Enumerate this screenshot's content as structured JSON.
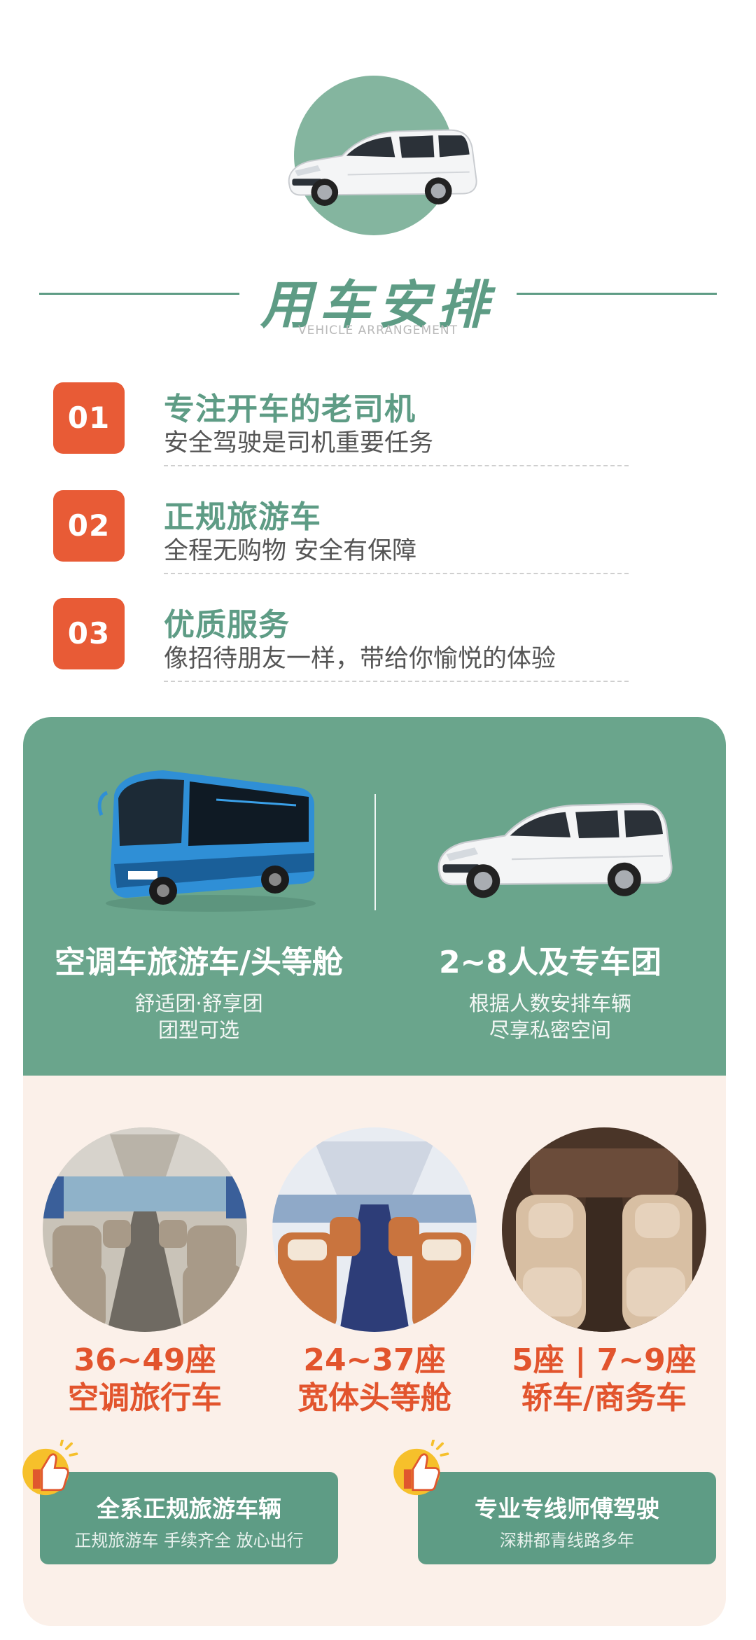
{
  "header": {
    "title": "用车安排",
    "subtitle": "VEHICLE ARRANGEMENT"
  },
  "features": [
    {
      "num": "01",
      "title": "专注开车的老司机",
      "desc": "安全驾驶是司机重要任务"
    },
    {
      "num": "02",
      "title": "正规旅游车",
      "desc": "全程无购物 安全有保障"
    },
    {
      "num": "03",
      "title": "优质服务",
      "desc": "像招待朋友一样，带给你愉悦的体验"
    }
  ],
  "vehicles": [
    {
      "title": "空调车旅游车/头等舱",
      "line1": "舒适团·舒享团",
      "line2": "团型可选"
    },
    {
      "title": "2~8人及专车团",
      "line1": "根据人数安排车辆",
      "line2": "尽享私密空间"
    }
  ],
  "seats": [
    {
      "count": "36~49座",
      "type": "空调旅行车"
    },
    {
      "count": "24~37座",
      "type": "宽体头等舱"
    },
    {
      "count": "5座 | 7~9座",
      "type": "轿车/商务车"
    }
  ],
  "badges": [
    {
      "title": "全系正规旅游车辆",
      "sub": "正规旅游车 手续齐全 放心出行"
    },
    {
      "title": "专业专线师傅驾驶",
      "sub": "深耕都青线路多年"
    }
  ],
  "colors": {
    "green": "#5e9c85",
    "card_green": "#6aa58c",
    "orange": "#e85b36",
    "cream": "#fbf0e9"
  },
  "icons": [
    "minivan-image",
    "coach-bus-image",
    "thumbs-up-icon"
  ]
}
